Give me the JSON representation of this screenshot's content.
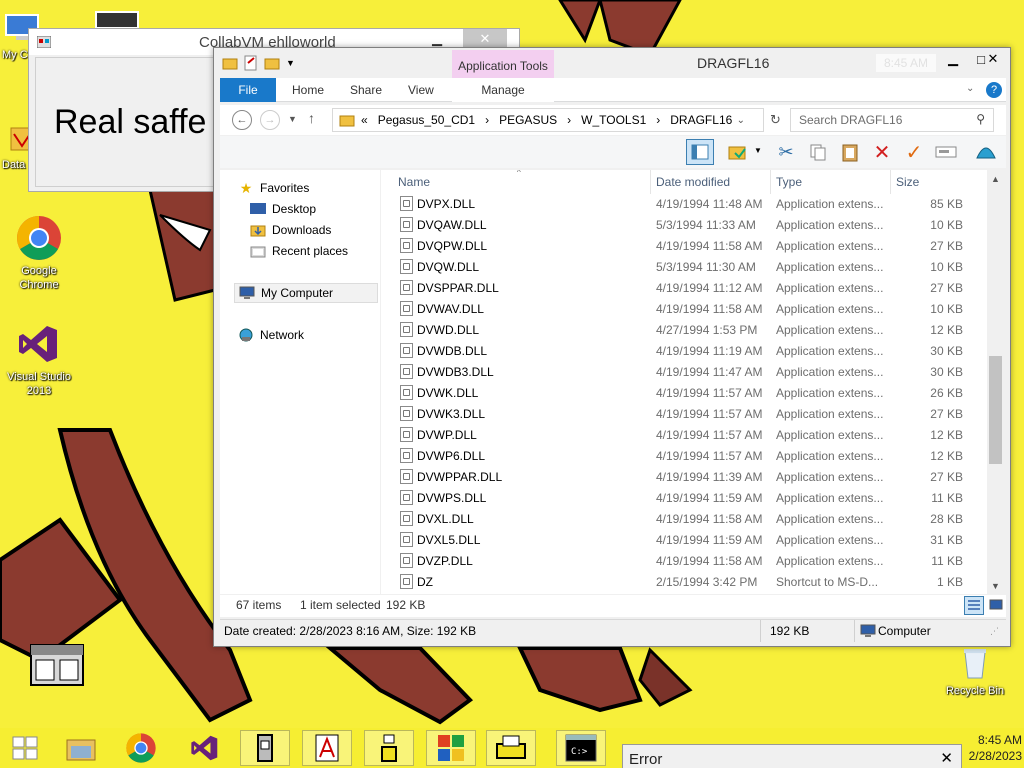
{
  "desktop": {
    "icons": [
      {
        "label": "My C"
      },
      {
        "label": "Data"
      },
      {
        "label": "Google Chrome"
      },
      {
        "label": "Visual Studio 2013"
      },
      {
        "label": "Recycle Bin"
      }
    ]
  },
  "collab_window": {
    "title": "CollabVM ehlloworld",
    "body_text": "Real saffe"
  },
  "explorer": {
    "title": "DRAGFL16",
    "ghost_time": "8:45 AM",
    "context_tab": "Application Tools",
    "ribbon_tabs": {
      "file": "File",
      "home": "Home",
      "share": "Share",
      "view": "View",
      "manage": "Manage"
    },
    "address": {
      "prefix": "«",
      "crumbs": [
        "Pegasus_50_CD1",
        "PEGASUS",
        "W_TOOLS1",
        "DRAGFL16"
      ]
    },
    "search_placeholder": "Search DRAGFL16",
    "nav": {
      "favorites": "Favorites",
      "desktop": "Desktop",
      "downloads": "Downloads",
      "recent": "Recent places",
      "computer": "My Computer",
      "network": "Network"
    },
    "columns": {
      "name": "Name",
      "date": "Date modified",
      "type": "Type",
      "size": "Size"
    },
    "files": [
      {
        "name": "DVPX.DLL",
        "date": "4/19/1994 11:48 AM",
        "type": "Application extens...",
        "size": "85 KB"
      },
      {
        "name": "DVQAW.DLL",
        "date": "5/3/1994 11:33 AM",
        "type": "Application extens...",
        "size": "10 KB"
      },
      {
        "name": "DVQPW.DLL",
        "date": "4/19/1994 11:58 AM",
        "type": "Application extens...",
        "size": "27 KB"
      },
      {
        "name": "DVQW.DLL",
        "date": "5/3/1994 11:30 AM",
        "type": "Application extens...",
        "size": "10 KB"
      },
      {
        "name": "DVSPPAR.DLL",
        "date": "4/19/1994 11:12 AM",
        "type": "Application extens...",
        "size": "27 KB"
      },
      {
        "name": "DVWAV.DLL",
        "date": "4/19/1994 11:58 AM",
        "type": "Application extens...",
        "size": "10 KB"
      },
      {
        "name": "DVWD.DLL",
        "date": "4/27/1994 1:53 PM",
        "type": "Application extens...",
        "size": "12 KB"
      },
      {
        "name": "DVWDB.DLL",
        "date": "4/19/1994 11:19 AM",
        "type": "Application extens...",
        "size": "30 KB"
      },
      {
        "name": "DVWDB3.DLL",
        "date": "4/19/1994 11:47 AM",
        "type": "Application extens...",
        "size": "30 KB"
      },
      {
        "name": "DVWK.DLL",
        "date": "4/19/1994 11:57 AM",
        "type": "Application extens...",
        "size": "26 KB"
      },
      {
        "name": "DVWK3.DLL",
        "date": "4/19/1994 11:57 AM",
        "type": "Application extens...",
        "size": "27 KB"
      },
      {
        "name": "DVWP.DLL",
        "date": "4/19/1994 11:57 AM",
        "type": "Application extens...",
        "size": "12 KB"
      },
      {
        "name": "DVWP6.DLL",
        "date": "4/19/1994 11:57 AM",
        "type": "Application extens...",
        "size": "12 KB"
      },
      {
        "name": "DVWPPAR.DLL",
        "date": "4/19/1994 11:39 AM",
        "type": "Application extens...",
        "size": "27 KB"
      },
      {
        "name": "DVWPS.DLL",
        "date": "4/19/1994 11:59 AM",
        "type": "Application extens...",
        "size": "11 KB"
      },
      {
        "name": "DVXL.DLL",
        "date": "4/19/1994 11:58 AM",
        "type": "Application extens...",
        "size": "28 KB"
      },
      {
        "name": "DVXL5.DLL",
        "date": "4/19/1994 11:59 AM",
        "type": "Application extens...",
        "size": "31 KB"
      },
      {
        "name": "DVZP.DLL",
        "date": "4/19/1994 11:58 AM",
        "type": "Application extens...",
        "size": "11 KB"
      },
      {
        "name": "DZ",
        "date": "2/15/1994 3:42 PM",
        "type": "Shortcut to MS-D...",
        "size": "1 KB"
      }
    ],
    "status": {
      "count": "67 items",
      "selected": "1 item selected",
      "selected_size": "192 KB"
    },
    "details": {
      "created": "Date created: 2/28/2023 8:16 AM, Size: 192 KB",
      "size": "192 KB",
      "location": "Computer"
    }
  },
  "taskbar": {
    "time": "8:45 AM",
    "date": "2/28/2023"
  },
  "error_window": {
    "title": "Error"
  },
  "colors": {
    "wallpaper": "#f7ef3a",
    "deer": "#8b3a2f",
    "accent": "#1979ca",
    "context_tab": "#f3cff0"
  }
}
